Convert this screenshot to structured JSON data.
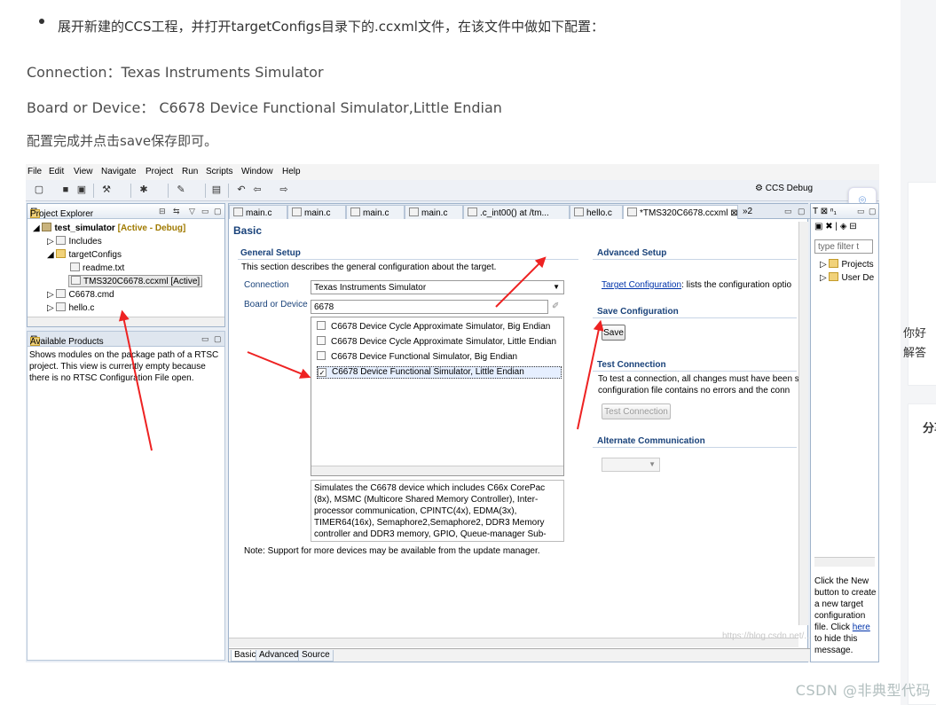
{
  "article": {
    "bullet": "展开新建的CCS工程，并打开targetConfigs目录下的.ccxml文件，在该文件中做如下配置：",
    "connection_line": "Connection：Texas Instruments Simulator",
    "board_line": "Board or Device：  C6678 Device Functional Simulator,Little Endian",
    "save_line": "配置完成并点击save保存即可。",
    "watermark": "CSDN @非典型代码",
    "side_text_1": "你好",
    "side_text_2": "解答",
    "side_text_3": "分享"
  },
  "eclipse": {
    "menu": [
      "File",
      "Edit",
      "View",
      "Navigate",
      "Project",
      "Run",
      "Scripts",
      "Window",
      "Help"
    ],
    "perspective": "CCS Debug",
    "project_explorer": {
      "title": "Project Explorer",
      "project": "test_simulator",
      "project_tag": "[Active - Debug]",
      "items": [
        "Includes",
        "targetConfigs",
        "readme.txt",
        "TMS320C6678.ccxml [Active]",
        "C6678.cmd",
        "hello.c"
      ]
    },
    "available_products": {
      "title": "Available Products",
      "text": [
        "Shows modules on the package path of a RTSC",
        "project. This view is currently empty because",
        "there is no RTSC Configuration File open."
      ]
    },
    "tabs": [
      "main.c",
      "main.c",
      "main.c",
      "main.c",
      ".c_int00() at /tm...",
      "hello.c",
      "*TMS320C6678.ccxml",
      "»2"
    ],
    "editor": {
      "heading": "Basic",
      "general_setup": "General Setup",
      "general_desc": "This section describes the general configuration about the target.",
      "connection_label": "Connection",
      "connection_value": "Texas Instruments Simulator",
      "board_label": "Board or Device",
      "board_filter": "6678",
      "devices": [
        {
          "label": "C6678 Device Cycle Approximate Simulator, Big Endian",
          "checked": false
        },
        {
          "label": "C6678 Device Cycle Approximate Simulator, Little Endian",
          "checked": false
        },
        {
          "label": "C6678 Device Functional Simulator, Big Endian",
          "checked": false
        },
        {
          "label": "C6678 Device Functional Simulator, Little Endian",
          "checked": true
        }
      ],
      "description": [
        "Simulates the C6678 device which includes C66x CorePac",
        "(8x), MSMC (Multicore Shared Memory Controller), Inter-",
        "processor communication, CPINTC(4x), EDMA(3x),",
        "TIMER64(16x), Semaphore2,Semaphore2, DDR3 Memory",
        "controller and DDR3 memory, GPIO, Queue-manager Sub-"
      ],
      "note": "Note: Support for more devices may be available from the update manager.",
      "advanced_setup": "Advanced Setup",
      "target_config_link": "Target Configuration",
      "target_config_text": ": lists the configuration optio",
      "save_configuration": "Save Configuration",
      "save_button": "Save",
      "test_connection": "Test Connection",
      "test_desc": [
        "To test a connection, all changes must have been s",
        "configuration file contains no errors and the conn"
      ],
      "test_button": "Test Connection",
      "alternate": "Alternate Communication",
      "bottom_tabs": [
        "Basic",
        "Advanced",
        "Source"
      ]
    },
    "right_panel": {
      "filter_placeholder": "type filter t",
      "items": [
        "Projects",
        "User De"
      ],
      "help": [
        "Click the New",
        "button to create",
        "a new target",
        "configuration",
        "file. Click"
      ],
      "help_link": "here",
      "help_tail": [
        "to hide this",
        "message."
      ]
    },
    "url_watermark": "https://blog.csdn.net/..."
  }
}
